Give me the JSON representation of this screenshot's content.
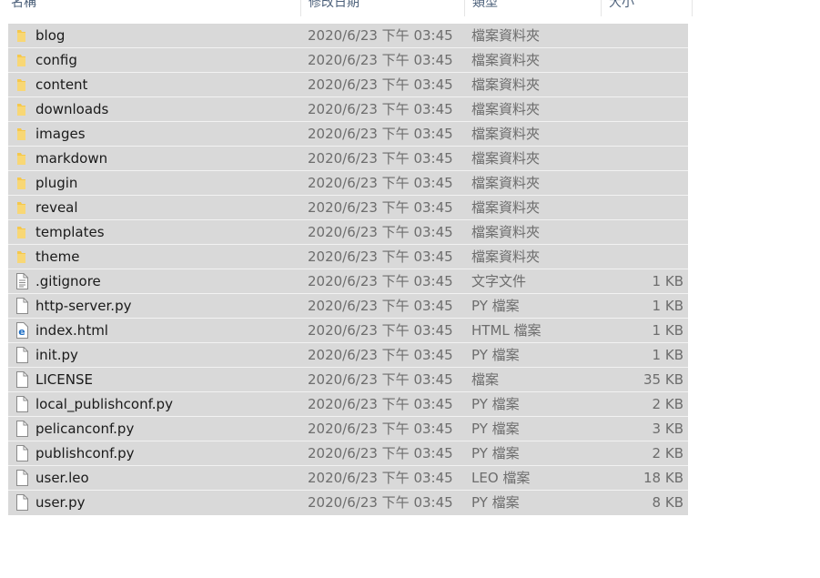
{
  "columns": {
    "name": "名稱",
    "modified": "修改日期",
    "type": "類型",
    "size": "大小"
  },
  "colors": {
    "row_bg": "#d9d9d9",
    "folder": "#f5c84c",
    "ie_blue": "#1f6fc5"
  },
  "files": [
    {
      "name": "blog",
      "date": "2020/6/23 下午 03:45",
      "type": "檔案資料夾",
      "size": "",
      "icon": "folder-icon"
    },
    {
      "name": "config",
      "date": "2020/6/23 下午 03:45",
      "type": "檔案資料夾",
      "size": "",
      "icon": "folder-icon"
    },
    {
      "name": "content",
      "date": "2020/6/23 下午 03:45",
      "type": "檔案資料夾",
      "size": "",
      "icon": "folder-icon"
    },
    {
      "name": "downloads",
      "date": "2020/6/23 下午 03:45",
      "type": "檔案資料夾",
      "size": "",
      "icon": "folder-icon"
    },
    {
      "name": "images",
      "date": "2020/6/23 下午 03:45",
      "type": "檔案資料夾",
      "size": "",
      "icon": "folder-icon"
    },
    {
      "name": "markdown",
      "date": "2020/6/23 下午 03:45",
      "type": "檔案資料夾",
      "size": "",
      "icon": "folder-icon"
    },
    {
      "name": "plugin",
      "date": "2020/6/23 下午 03:45",
      "type": "檔案資料夾",
      "size": "",
      "icon": "folder-icon"
    },
    {
      "name": "reveal",
      "date": "2020/6/23 下午 03:45",
      "type": "檔案資料夾",
      "size": "",
      "icon": "folder-icon"
    },
    {
      "name": "templates",
      "date": "2020/6/23 下午 03:45",
      "type": "檔案資料夾",
      "size": "",
      "icon": "folder-icon"
    },
    {
      "name": "theme",
      "date": "2020/6/23 下午 03:45",
      "type": "檔案資料夾",
      "size": "",
      "icon": "folder-icon"
    },
    {
      "name": ".gitignore",
      "date": "2020/6/23 下午 03:45",
      "type": "文字文件",
      "size": "1 KB",
      "icon": "text-file-icon"
    },
    {
      "name": "http-server.py",
      "date": "2020/6/23 下午 03:45",
      "type": "PY 檔案",
      "size": "1 KB",
      "icon": "file-icon"
    },
    {
      "name": "index.html",
      "date": "2020/6/23 下午 03:45",
      "type": "HTML 檔案",
      "size": "1 KB",
      "icon": "html-file-icon"
    },
    {
      "name": "init.py",
      "date": "2020/6/23 下午 03:45",
      "type": "PY 檔案",
      "size": "1 KB",
      "icon": "file-icon"
    },
    {
      "name": "LICENSE",
      "date": "2020/6/23 下午 03:45",
      "type": "檔案",
      "size": "35 KB",
      "icon": "file-icon"
    },
    {
      "name": "local_publishconf.py",
      "date": "2020/6/23 下午 03:45",
      "type": "PY 檔案",
      "size": "2 KB",
      "icon": "file-icon"
    },
    {
      "name": "pelicanconf.py",
      "date": "2020/6/23 下午 03:45",
      "type": "PY 檔案",
      "size": "3 KB",
      "icon": "file-icon"
    },
    {
      "name": "publishconf.py",
      "date": "2020/6/23 下午 03:45",
      "type": "PY 檔案",
      "size": "2 KB",
      "icon": "file-icon"
    },
    {
      "name": "user.leo",
      "date": "2020/6/23 下午 03:45",
      "type": "LEO 檔案",
      "size": "18 KB",
      "icon": "file-icon"
    },
    {
      "name": "user.py",
      "date": "2020/6/23 下午 03:45",
      "type": "PY 檔案",
      "size": "8 KB",
      "icon": "file-icon"
    }
  ]
}
